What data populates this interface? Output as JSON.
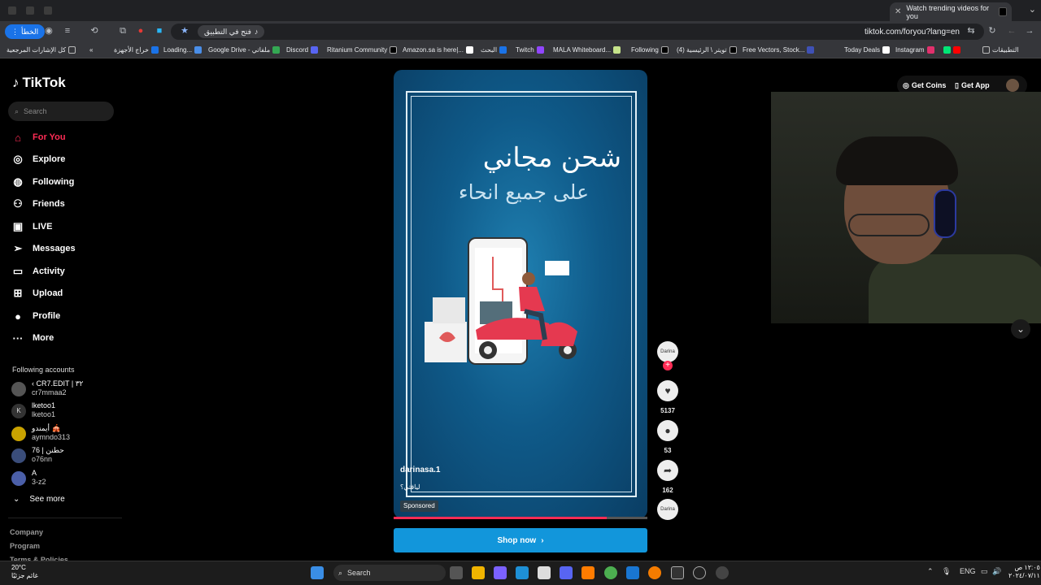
{
  "browser": {
    "tab_title": "Watch trending videos for you",
    "url": "tiktok.com/foryou?lang=en",
    "open_in_app": "فتح في التطبيق",
    "error_btn": "الخطأ",
    "bookmarks": [
      "كل الإشارات المرجعية",
      "خراج الأجهزة",
      "Loading...",
      "Google Drive - ملفاتي",
      "Discord",
      "Ritanium Community",
      "Amazon.sa is here|...",
      "البحث",
      "Twitch",
      "MALA Whiteboard...",
      "Following",
      "(4) تويتر \\ الرئيسية",
      "Free Vectors, Stock...",
      "Today Deals",
      "Instagram",
      "التطبيقات"
    ]
  },
  "tiktok": {
    "logo": "TikTok",
    "search_placeholder": "Search",
    "nav": [
      "For You",
      "Explore",
      "Following",
      "Friends",
      "LIVE",
      "Messages",
      "Activity",
      "Upload",
      "Profile",
      "More"
    ],
    "following_title": "Following accounts",
    "accounts": [
      {
        "name": "‹ CR7.EDIT | ٣٢",
        "handle": "cr7mmaa2"
      },
      {
        "name": "lketoo1",
        "handle": "lketoo1"
      },
      {
        "name": "أيمندو 🎪",
        "handle": "aymndo313"
      },
      {
        "name": "76 | حطنن",
        "handle": "o76nn"
      },
      {
        "name": "A",
        "handle": "3-z2"
      }
    ],
    "see_more": "See more",
    "footer": [
      "Company",
      "Program",
      "Terms & Policies"
    ],
    "get_coins": "Get Coins",
    "get_app": "Get App",
    "video": {
      "line1": "شحن مجاني",
      "line2": "على جميع انحاء",
      "username": "darinasa.1",
      "caption": "لياقتي؟",
      "sponsored": "Sponsored",
      "likes": "5137",
      "comments": "53",
      "shares": "162",
      "avatar_text": "Darina",
      "progress": 0.84
    },
    "shop_now": "Shop now"
  },
  "taskbar": {
    "weather_temp": "20°C",
    "weather_desc": "غائم جزئيًا",
    "search": "Search",
    "lang": "ENG",
    "time": "١٢:٠٥ ص",
    "date": "٢٠٢٤/٠٧/١١"
  }
}
